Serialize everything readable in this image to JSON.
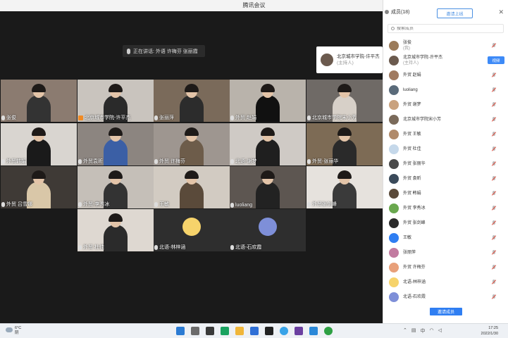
{
  "window": {
    "title": "腾讯会议"
  },
  "speaking": {
    "text": "正在讲话: 外语 许梅芬 张丽霞"
  },
  "host_float": {
    "name": "北京城市学院-许平杰",
    "role": "(主持人)"
  },
  "tiles": [
    {
      "label": "张俊",
      "bg": "#8b7b70",
      "clothing": "#333333"
    },
    {
      "label": "北京城市学院-许平杰",
      "bg": "#c9c4be",
      "clothing": "#2a2a2a",
      "host": true
    },
    {
      "label": "张丽萍",
      "bg": "#7a6a5a",
      "clothing": "#2c2c2c"
    },
    {
      "label": "外贸 赵娟",
      "bg": "#b9b3ab",
      "clothing": "#111111"
    },
    {
      "label": "北京城市学院宋小芳",
      "bg": "#6f6a66",
      "clothing": "#d7d0c8"
    },
    {
      "label": "外贸韩娟",
      "bg": "#d9d5d0",
      "clothing": "#1a1a1a"
    },
    {
      "label": "外贸袁昕",
      "bg": "#8c8580",
      "clothing": "#3b5fa5"
    },
    {
      "label": "外贸 许梅芬",
      "bg": "#9e9690",
      "clothing": "#6d5c4a"
    },
    {
      "label": "北语-谢梦",
      "bg": "#cfcac5",
      "clothing": "#1f1f1f"
    },
    {
      "label": "外贸-张丽华",
      "bg": "#7d6b55",
      "clothing": "#2a2a2a"
    },
    {
      "label": "外贸 吕雪娜",
      "bg": "#3f3a36",
      "clothing": "#d9c7a8"
    },
    {
      "label": "外贸-李秀冰",
      "bg": "#c5bfb8",
      "clothing": "#333333"
    },
    {
      "label": "王敏",
      "bg": "#d2cbc2",
      "clothing": "#5a4a3a"
    },
    {
      "label": "luoliang",
      "bg": "#5d5651",
      "clothing": "#222222"
    },
    {
      "label": "外贸张剑峰",
      "bg": "#e6e2dd",
      "clothing": "#3a3a3a"
    },
    {
      "label": "外贸 杜佳",
      "bg": "#ded8d1",
      "clothing": "#2b2b2b"
    },
    {
      "label": "北语-林梓涵",
      "bg": "#2e2e2e",
      "avatar": "#f6d36b"
    },
    {
      "label": "北语-石欢霞",
      "bg": "#2e2e2e",
      "avatar": "#7e8fd8"
    }
  ],
  "panel": {
    "title": "成员(18)",
    "share_label": "邀请上线",
    "close_label": "✕",
    "search_placeholder": "搜索成员",
    "participants": [
      {
        "name": "张俊",
        "sub": "(我)",
        "color": "#9b7b5a",
        "muted": true
      },
      {
        "name": "北京城市学院-许平杰",
        "sub": "(主持人)",
        "color": "#6b5a4e",
        "muted": false,
        "button": "视频"
      },
      {
        "name": "外贸 赵娟",
        "color": "#a07a60",
        "muted": true
      },
      {
        "name": "luoliang",
        "color": "#5a6b7a",
        "muted": true
      },
      {
        "name": "外贸 谢梦",
        "color": "#c9a27e",
        "muted": true
      },
      {
        "name": "北京城市学院宋小芳",
        "color": "#7a6a5a",
        "muted": true
      },
      {
        "name": "外贸 王敏",
        "color": "#b08a6a",
        "muted": true
      },
      {
        "name": "外贸 杜佳",
        "color": "#c5d8ea",
        "muted": true
      },
      {
        "name": "外贸 张丽华",
        "color": "#4a4a4a",
        "muted": true
      },
      {
        "name": "外贸 袁昕",
        "color": "#3a4a5a",
        "muted": true
      },
      {
        "name": "外贸 韩娟",
        "color": "#5a4a3a",
        "muted": true
      },
      {
        "name": "外贸 李秀冰",
        "color": "#6aa84f",
        "muted": true
      },
      {
        "name": "外贸 张剑峰",
        "color": "#2a2a2a",
        "muted": true
      },
      {
        "name": "王敏",
        "color": "#2f7ef2",
        "muted": true
      },
      {
        "name": "张丽萍",
        "color": "#c27ba0",
        "muted": true
      },
      {
        "name": "外贸 许梅芬",
        "color": "#e8a07a",
        "muted": true
      },
      {
        "name": "北语-林梓涵",
        "color": "#f6d36b",
        "muted": true
      },
      {
        "name": "北语-石欢霞",
        "color": "#7e8fd8",
        "muted": true
      }
    ],
    "invite_label": "邀请成员"
  },
  "taskbar": {
    "weather_temp": "6°C",
    "weather_desc": "阴",
    "time": "17:25",
    "date": "2022/1/30"
  }
}
